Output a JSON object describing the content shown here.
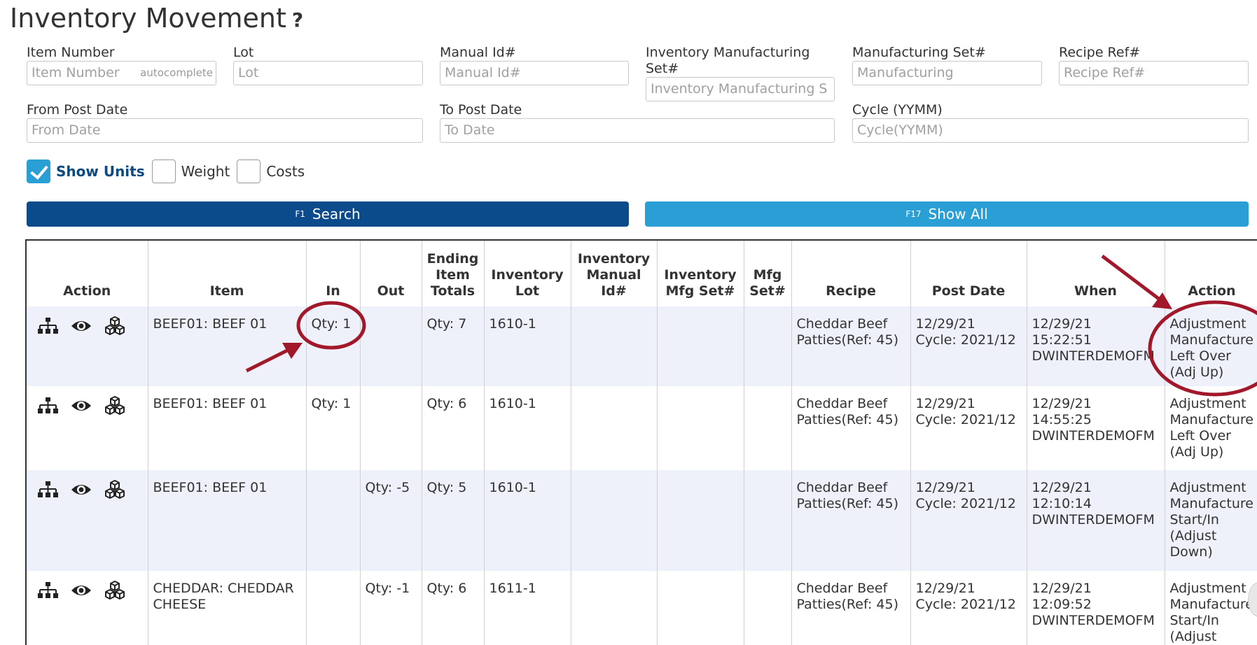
{
  "page": {
    "title": "Inventory Movement",
    "help_glyph": "?"
  },
  "filters": {
    "item_number": {
      "label": "Item Number",
      "placeholder": "Item Number",
      "hint": "autocomplete"
    },
    "lot": {
      "label": "Lot",
      "placeholder": "Lot"
    },
    "manual_id": {
      "label": "Manual Id#",
      "placeholder": "Manual Id#"
    },
    "inv_mfg_set": {
      "label_line1": "Inventory Manufacturing",
      "label_line2": "Set#",
      "placeholder": "Inventory Manufacturing S"
    },
    "mfg_set": {
      "label": "Manufacturing Set#",
      "placeholder": "Manufacturing"
    },
    "recipe_ref": {
      "label": "Recipe Ref#",
      "placeholder": "Recipe Ref#"
    },
    "from_post_date": {
      "label": "From Post Date",
      "placeholder": "From Date"
    },
    "to_post_date": {
      "label": "To Post Date",
      "placeholder": "To Date"
    },
    "cycle": {
      "label": "Cycle (YYMM)",
      "placeholder": "Cycle(YYMM)"
    }
  },
  "options": {
    "show_units": {
      "label": "Show Units",
      "checked": true
    },
    "weight": {
      "label": "Weight",
      "checked": false
    },
    "costs": {
      "label": "Costs",
      "checked": false
    }
  },
  "buttons": {
    "search": {
      "key": "F1",
      "label": "Search"
    },
    "show_all": {
      "key": "F17",
      "label": "Show All"
    }
  },
  "table": {
    "headers": {
      "action": "Action",
      "item": "Item",
      "in": "In",
      "out": "Out",
      "ending_l1": "Ending",
      "ending_l2": "Item",
      "ending_l3": "Totals",
      "lot_l1": "Inventory",
      "lot_l2": "Lot",
      "manual_l1": "Inventory",
      "manual_l2": "Manual",
      "manual_l3": "Id#",
      "mfgset_l1": "Inventory",
      "mfgset_l2": "Mfg Set#",
      "mfg_l1": "Mfg",
      "mfg_l2": "Set#",
      "recipe": "Recipe",
      "post_date": "Post Date",
      "when": "When",
      "action2": "Action"
    },
    "rows": [
      {
        "item": "BEEF01: BEEF 01",
        "in": "Qty: 1",
        "out": "",
        "ending": "Qty: 7",
        "lot": "1610-1",
        "manual": "",
        "inv_mfg_set": "",
        "mfg_set": "",
        "recipe_l1": "Cheddar Beef",
        "recipe_l2": "Patties(Ref: 45)",
        "post_l1": "12/29/21",
        "post_l2": "Cycle: 2021/12",
        "when_l1": "12/29/21",
        "when_l2": "15:22:51",
        "when_l3": "DWINTERDEMOFM",
        "action_lines": [
          "Adjustment",
          "Manufacture",
          "Left Over",
          "(Adj Up)"
        ]
      },
      {
        "item": "BEEF01: BEEF 01",
        "in": "Qty: 1",
        "out": "",
        "ending": "Qty: 6",
        "lot": "1610-1",
        "manual": "",
        "inv_mfg_set": "",
        "mfg_set": "",
        "recipe_l1": "Cheddar Beef",
        "recipe_l2": "Patties(Ref: 45)",
        "post_l1": "12/29/21",
        "post_l2": "Cycle: 2021/12",
        "when_l1": "12/29/21",
        "when_l2": "14:55:25",
        "when_l3": "DWINTERDEMOFM",
        "action_lines": [
          "Adjustment",
          "Manufacture",
          "Left Over",
          "(Adj Up)"
        ]
      },
      {
        "item": "BEEF01: BEEF 01",
        "in": "",
        "out": "Qty: -5",
        "ending": "Qty: 5",
        "lot": "1610-1",
        "manual": "",
        "inv_mfg_set": "",
        "mfg_set": "",
        "recipe_l1": "Cheddar Beef",
        "recipe_l2": "Patties(Ref: 45)",
        "post_l1": "12/29/21",
        "post_l2": "Cycle: 2021/12",
        "when_l1": "12/29/21",
        "when_l2": "12:10:14",
        "when_l3": "DWINTERDEMOFM",
        "action_lines": [
          "Adjustment",
          "Manufacture",
          "Start/In",
          "(Adjust",
          "Down)"
        ]
      },
      {
        "item_l1": "CHEDDAR: CHEDDAR",
        "item_l2": "CHEESE",
        "in": "",
        "out": "Qty: -1",
        "ending": "Qty: 6",
        "lot": "1611-1",
        "manual": "",
        "inv_mfg_set": "",
        "mfg_set": "",
        "recipe_l1": "Cheddar Beef",
        "recipe_l2": "Patties(Ref: 45)",
        "post_l1": "12/29/21",
        "post_l2": "Cycle: 2021/12",
        "when_l1": "12/29/21",
        "when_l2": "12:09:52",
        "when_l3": "DWINTERDEMOFM",
        "action_lines": [
          "Adjustment",
          "Manufacture",
          "Start/In",
          "(Adjust"
        ]
      }
    ]
  },
  "annotation_color": "#a0182a",
  "accent": {
    "dark_blue": "#0b4a8b",
    "light_blue": "#2a9fd6",
    "row_tint": "#eef0fa"
  }
}
